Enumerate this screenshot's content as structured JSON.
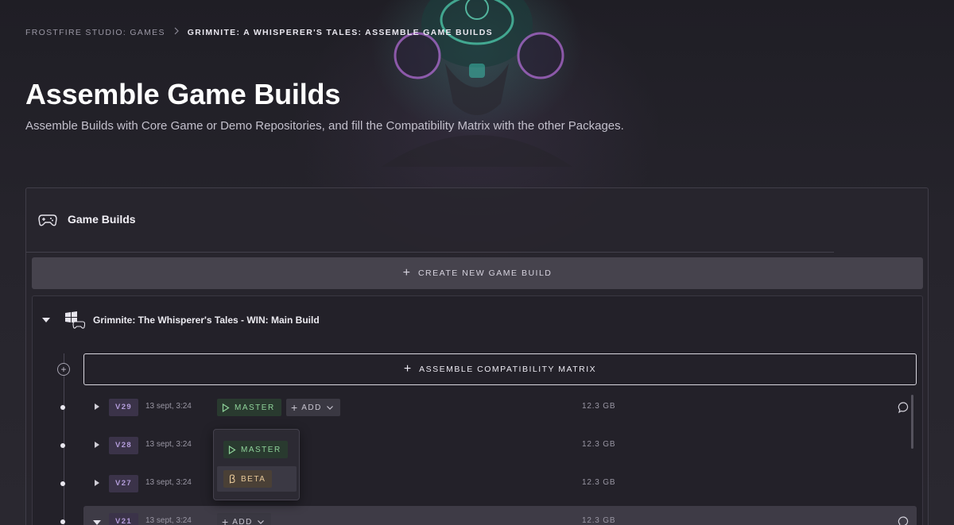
{
  "breadcrumb": {
    "items": [
      "FROSTFIRE STUDIO: GAMES"
    ],
    "current": "GRIMNITE: A WHISPERER'S TALES: ASSEMBLE GAME BUILDS"
  },
  "page": {
    "title": "Assemble Game Builds",
    "subtitle": "Assemble Builds with Core Game or Demo Repositories, and fill the Compatibility Matrix with the other Packages."
  },
  "panel": {
    "title": "Game Builds",
    "icon": "gamepad-icon",
    "create_button_label": "CREATE NEW GAME BUILD"
  },
  "build": {
    "name": "Grimnite: The Whisperer's Tales -  WIN: Main Build",
    "icon": "windows-gamepad-icon",
    "assemble_button_label": "ASSEMBLE COMPATIBILITY MATRIX",
    "versions": [
      {
        "version": "V29",
        "date": "13 sept, 3:24",
        "branch": "MASTER",
        "add_label": "ADD",
        "size": "12.3 GB",
        "expanded": false
      },
      {
        "version": "V28",
        "date": "13 sept, 3:24",
        "size": "12.3 GB",
        "expanded": false
      },
      {
        "version": "V27",
        "date": "13 sept, 3:24",
        "size": "12.3 GB",
        "expanded": false
      },
      {
        "version": "V21",
        "date": "13 sept, 3:24",
        "add_label": "ADD",
        "size": "12.3 GB",
        "expanded": true
      }
    ]
  },
  "branch_dropdown": {
    "options": [
      "MASTER",
      "BETA"
    ],
    "hovered": "BETA"
  },
  "colors": {
    "accent_master": "#8fd39a",
    "accent_beta": "#e6c898",
    "version_badge": "#b49ddb",
    "background": "#2a2830"
  }
}
